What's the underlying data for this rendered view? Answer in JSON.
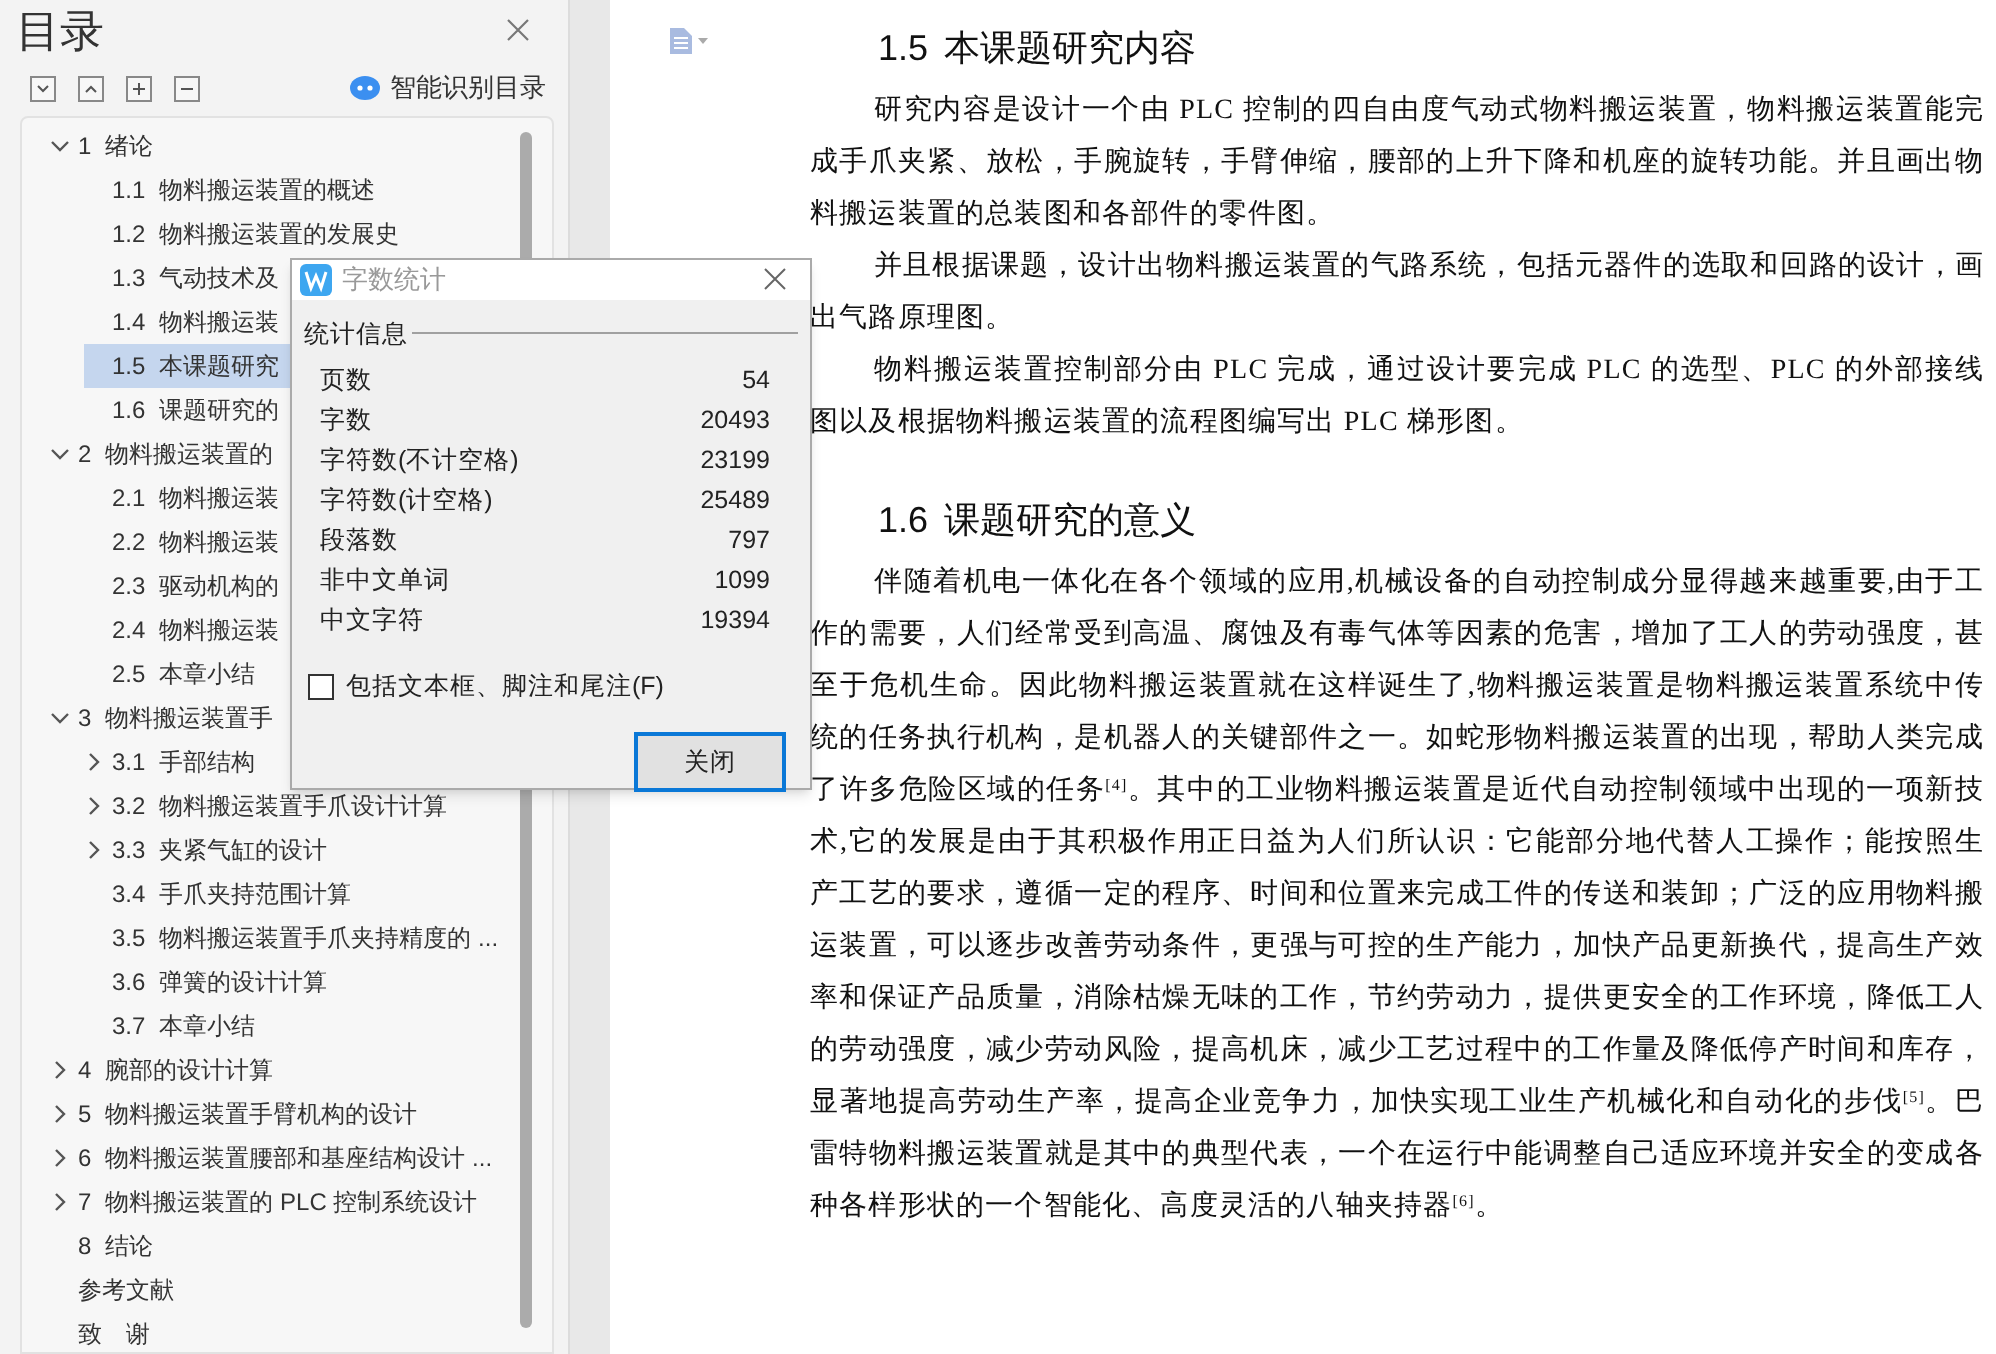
{
  "sidebar": {
    "title": "目录",
    "smart_button": "智能识别目录",
    "toc": [
      {
        "num": "1",
        "title": "绪论",
        "kind": "branch",
        "expanded": true,
        "selected": false,
        "children": [
          {
            "num": "1.1",
            "title": "物料搬运装置的概述",
            "kind": "leaf",
            "selected": false
          },
          {
            "num": "1.2",
            "title": "物料搬运装置的发展史",
            "kind": "leaf",
            "selected": false
          },
          {
            "num": "1.3",
            "title": "气动技术及",
            "kind": "leaf",
            "selected": false
          },
          {
            "num": "1.4",
            "title": "物料搬运装",
            "kind": "leaf",
            "selected": false
          },
          {
            "num": "1.5",
            "title": "本课题研究",
            "kind": "leaf",
            "selected": true
          },
          {
            "num": "1.6",
            "title": "课题研究的",
            "kind": "leaf",
            "selected": false
          }
        ]
      },
      {
        "num": "2",
        "title": "物料搬运装置的",
        "kind": "branch",
        "expanded": true,
        "selected": false,
        "children": [
          {
            "num": "2.1",
            "title": "物料搬运装",
            "kind": "leaf",
            "selected": false
          },
          {
            "num": "2.2",
            "title": "物料搬运装",
            "kind": "leaf",
            "selected": false
          },
          {
            "num": "2.3",
            "title": "驱动机构的",
            "kind": "leaf",
            "selected": false
          },
          {
            "num": "2.4",
            "title": "物料搬运装",
            "kind": "leaf",
            "selected": false
          },
          {
            "num": "2.5",
            "title": "本章小结",
            "kind": "leaf",
            "selected": false
          }
        ]
      },
      {
        "num": "3",
        "title": "物料搬运装置手",
        "kind": "branch",
        "expanded": true,
        "selected": false,
        "children": [
          {
            "num": "3.1",
            "title": "手部结构",
            "kind": "branch",
            "expanded": false,
            "selected": false
          },
          {
            "num": "3.2",
            "title": "物料搬运装置手爪设计计算",
            "kind": "branch",
            "expanded": false,
            "selected": false
          },
          {
            "num": "3.3",
            "title": "夹紧气缸的设计",
            "kind": "branch",
            "expanded": false,
            "selected": false
          },
          {
            "num": "3.4",
            "title": "手爪夹持范围计算",
            "kind": "leaf",
            "selected": false
          },
          {
            "num": "3.5",
            "title": "物料搬运装置手爪夹持精度的 ...",
            "kind": "leaf",
            "selected": false
          },
          {
            "num": "3.6",
            "title": "弹簧的设计计算",
            "kind": "leaf",
            "selected": false
          },
          {
            "num": "3.7",
            "title": "本章小结",
            "kind": "leaf",
            "selected": false
          }
        ]
      },
      {
        "num": "4",
        "title": "腕部的设计计算",
        "kind": "branch",
        "expanded": false,
        "selected": false
      },
      {
        "num": "5",
        "title": "物料搬运装置手臂机构的设计",
        "kind": "branch",
        "expanded": false,
        "selected": false
      },
      {
        "num": "6",
        "title": "物料搬运装置腰部和基座结构设计 ...",
        "kind": "branch",
        "expanded": false,
        "selected": false
      },
      {
        "num": "7",
        "title": "物料搬运装置的 PLC 控制系统设计",
        "kind": "branch",
        "expanded": false,
        "selected": false
      },
      {
        "num": "8",
        "title": "结论",
        "kind": "leaf",
        "selected": false
      },
      {
        "title": "参考文献",
        "kind": "leaf",
        "selected": false
      },
      {
        "title": "致　谢",
        "kind": "leaf",
        "selected": false
      }
    ]
  },
  "document": {
    "sections": [
      {
        "num": "1.5",
        "heading": "本课题研究内容",
        "paragraphs": [
          "研究内容是设计一个由 PLC 控制的四自由度气动式物料搬运装置，物料搬运装置能完成手爪夹紧、放松，手腕旋转，手臂伸缩，腰部的上升下降和机座的旋转功能。并且画出物料搬运装置的总装图和各部件的零件图。",
          "并且根据课题，设计出物料搬运装置的气路系统，包括元器件的选取和回路的设计，画出气路原理图。",
          "物料搬运装置控制部分由 PLC 完成，通过设计要完成 PLC 的选型、PLC 的外部接线图以及根据物料搬运装置的流程图编写出 PLC 梯形图。"
        ]
      },
      {
        "num": "1.6",
        "heading": "课题研究的意义",
        "paragraphs": [
          "伴随着机电一体化在各个领域的应用,机械设备的自动控制成分显得越来越重要,由于工作的需要，人们经常受到高温、腐蚀及有毒气体等因素的危害，增加了工人的劳动强度，甚至于危机生命。因此物料搬运装置就在这样诞生了,物料搬运装置是物料搬运装置系统中传统的任务执行机构，是机器人的关键部件之一。如蛇形物料搬运装置的出现，帮助人类完成了许多危险区域的任务$^{[4]}$。其中的工业物料搬运装置是近代自动控制领域中出现的一项新技术,它的发展是由于其积极作用正日益为人们所认识：它能部分地代替人工操作；能按照生产工艺的要求，遵循一定的程序、时间和位置来完成工件的传送和装卸；广泛的应用物料搬运装置，可以逐步改善劳动条件，更强与可控的生产能力，加快产品更新换代，提高生产效率和保证产品质量，消除枯燥无味的工作，节约劳动力，提供更安全的工作环境，降低工人的劳动强度，减少劳动风险，提高机床，减少工艺过程中的工作量及降低停产时间和库存，显著地提高劳动生产率，提高企业竞争力，加快实现工业生产机械化和自动化的步伐$^{[5]}$。巴雷特物料搬运装置就是其中的典型代表，一个在运行中能调整自己适应环境并安全的变成各种各样形状的一个智能化、高度灵活的八轴夹持器$^{[6]}$。"
        ]
      }
    ]
  },
  "dialog": {
    "title": "字数统计",
    "group": "统计信息",
    "rows": [
      {
        "label": "页数",
        "value": "54"
      },
      {
        "label": "字数",
        "value": "20493"
      },
      {
        "label": "字符数(不计空格)",
        "value": "23199"
      },
      {
        "label": "字符数(计空格)",
        "value": "25489"
      },
      {
        "label": "段落数",
        "value": "797"
      },
      {
        "label": "非中文单词",
        "value": "1099"
      },
      {
        "label": "中文字符",
        "value": "19394"
      }
    ],
    "checkbox": {
      "label": "包括文本框、脚注和尾注(F)",
      "checked": false
    },
    "button": "关闭"
  }
}
